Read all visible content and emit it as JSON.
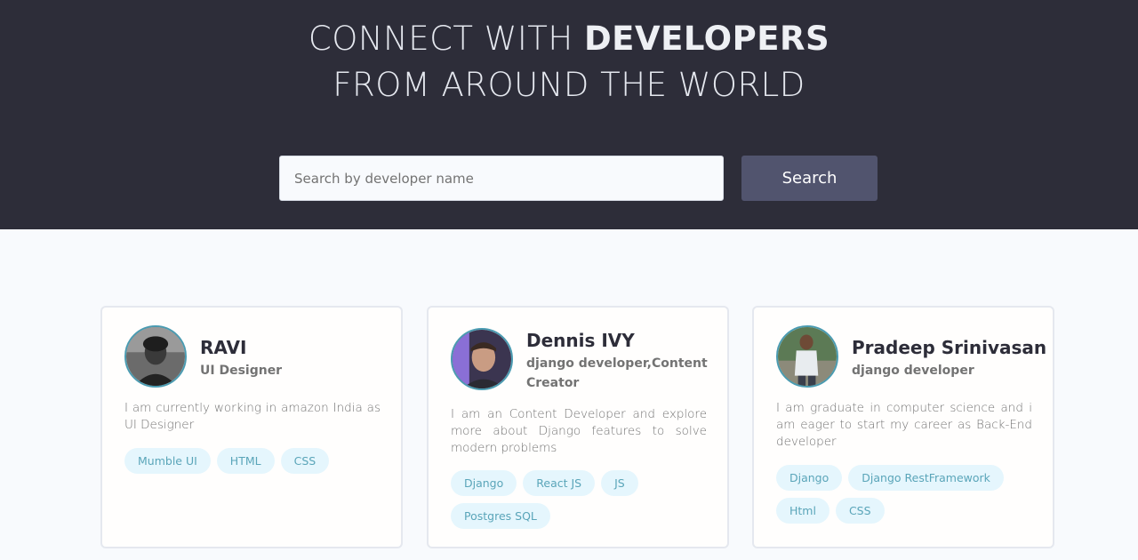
{
  "hero": {
    "title_line1_light": "CONNECT WITH ",
    "title_line1_bold": "DEVELOPERS",
    "title_line2": "FROM AROUND THE WORLD"
  },
  "search": {
    "placeholder": "Search by developer name",
    "value": "",
    "button_label": "Search"
  },
  "developers": [
    {
      "name": "RAVI",
      "role": "UI Designer",
      "bio": "I am currently working in amazon India as UI Designer",
      "skills": [
        "Mumble UI",
        "HTML",
        "CSS"
      ]
    },
    {
      "name": "Dennis IVY",
      "role": "django developer,Content Creator",
      "bio": "I am an Content Developer and explore more about Django features to solve modern problems",
      "skills": [
        "Django",
        "React JS",
        "JS",
        "Postgres SQL"
      ]
    },
    {
      "name": "Pradeep Srinivasan",
      "role": "django developer",
      "bio": "I am graduate in computer science and i am eager to start my career as Back-End developer",
      "skills": [
        "Django",
        "Django RestFramework",
        "Html",
        "CSS"
      ]
    }
  ],
  "colors": {
    "hero_bg": "#2d2d39",
    "page_bg": "#f8fafd",
    "button_bg": "#51546e",
    "tag_bg": "#e5f6fd",
    "tag_text": "#5aa5b9",
    "avatar_ring": "#4a9bb1"
  }
}
